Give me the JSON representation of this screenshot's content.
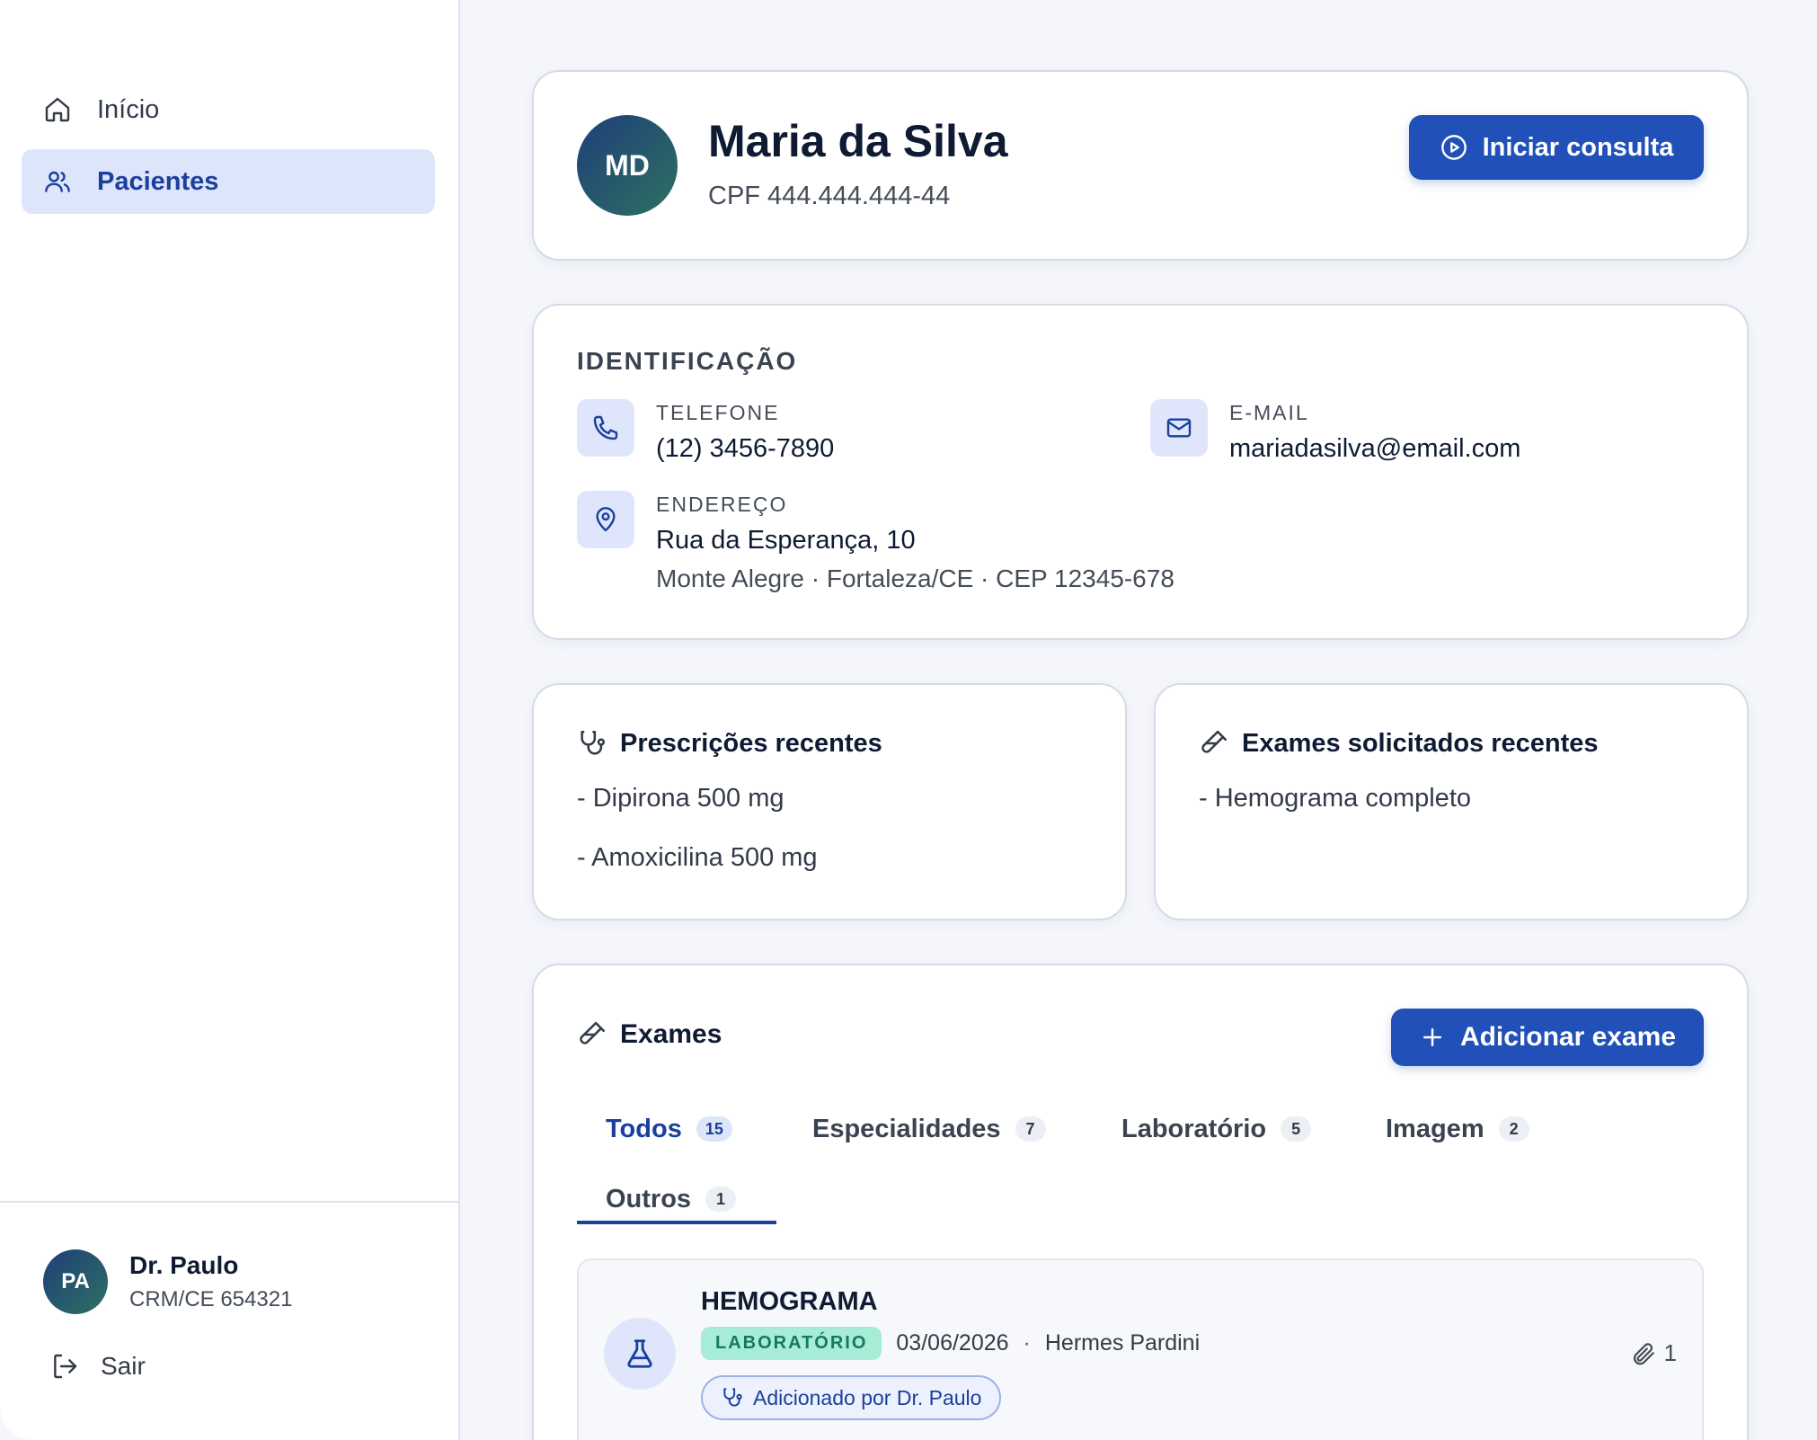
{
  "sidebar": {
    "nav": [
      {
        "label": "Início",
        "icon": "home-icon",
        "active": false
      },
      {
        "label": "Pacientes",
        "icon": "users-icon",
        "active": true
      }
    ],
    "user": {
      "initials": "PA",
      "name": "Dr. Paulo",
      "crm": "CRM/CE 654321"
    },
    "logout_label": "Sair"
  },
  "patient": {
    "initials": "MD",
    "name": "Maria da Silva",
    "cpf": "CPF 444.444.444-44",
    "start_button": "Iniciar consulta"
  },
  "identification": {
    "title": "IDENTIFICAÇÃO",
    "phone_label": "TELEFONE",
    "phone": "(12) 3456-7890",
    "email_label": "E-MAIL",
    "email": "mariadasilva@email.com",
    "address_label": "ENDEREÇO",
    "address_line1": "Rua da Esperança, 10",
    "address_line2": "Monte Alegre · Fortaleza/CE · CEP 12345-678"
  },
  "prescriptions": {
    "title": "Prescrições recentes",
    "items": [
      "- Dipirona 500 mg",
      "- Amoxicilina 500 mg"
    ]
  },
  "requested_exams": {
    "title": "Exames solicitados recentes",
    "items": [
      "- Hemograma completo"
    ]
  },
  "exams": {
    "title": "Exames",
    "add_button": "Adicionar exame",
    "tabs": [
      {
        "label": "Todos",
        "count": "15"
      },
      {
        "label": "Especialidades",
        "count": "7"
      },
      {
        "label": "Laboratório",
        "count": "5"
      },
      {
        "label": "Imagem",
        "count": "2"
      },
      {
        "label": "Outros",
        "count": "1"
      }
    ],
    "active_tab": "Todos",
    "items": [
      {
        "name": "HEMOGRAMA",
        "tag": "LABORATÓRIO",
        "date": "03/06/2026",
        "separator": "·",
        "lab": "Hermes Pardini",
        "added_by": "Adicionado por Dr. Paulo",
        "attachments": "1"
      }
    ]
  },
  "colors": {
    "primary": "#2150b8",
    "active_nav_bg": "#dde5fb",
    "tag_bg": "#a7ecd7",
    "tag_text": "#157a5c"
  }
}
